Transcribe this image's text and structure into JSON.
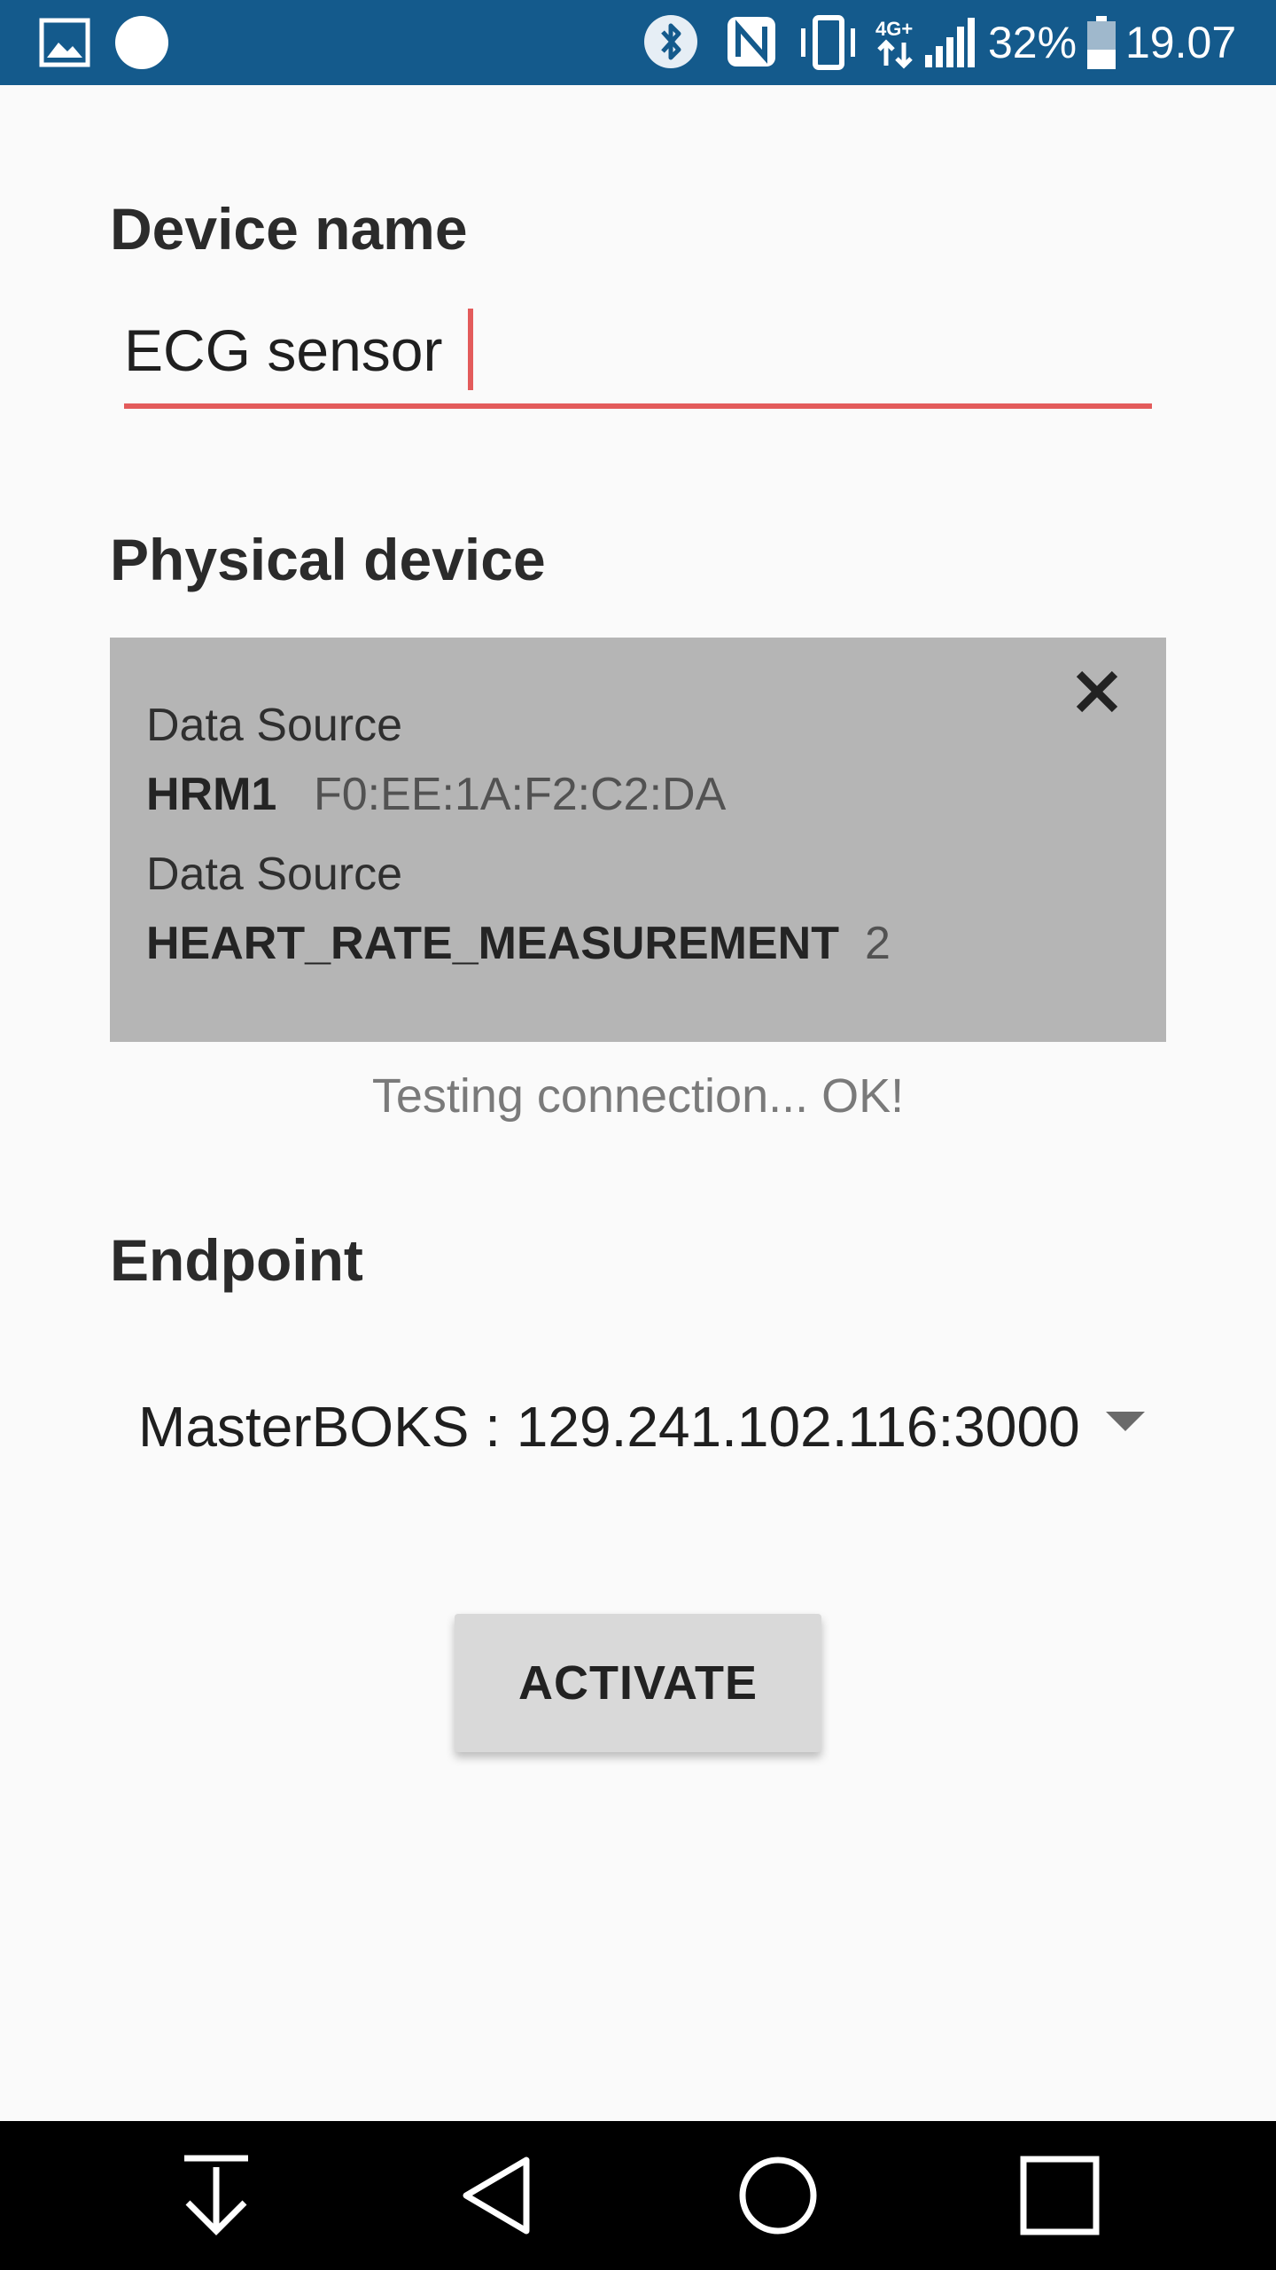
{
  "status_bar": {
    "battery_percent": "32%",
    "time": "19.07",
    "network_label": "4G+",
    "bg_color": "#145a8c",
    "icons": [
      "image-icon",
      "circle-icon",
      "bluetooth-icon",
      "nfc-icon",
      "vibrate-icon",
      "network-icon",
      "signal-icon",
      "battery-icon"
    ]
  },
  "device_name": {
    "heading": "Device name",
    "value": "ECG sensor",
    "accent_color": "#e35b5b"
  },
  "physical_device": {
    "heading": "Physical device",
    "source1": {
      "label": "Data Source",
      "name": "HRM1",
      "value": "F0:EE:1A:F2:C2:DA"
    },
    "source2": {
      "label": "Data Source",
      "name": "HEART_RATE_MEASUREMENT",
      "value": "2"
    },
    "status": "Testing connection... OK!"
  },
  "endpoint": {
    "heading": "Endpoint",
    "selected": "MasterBOKS : 129.241.102.116:3000"
  },
  "actions": {
    "activate_label": "ACTIVATE"
  },
  "nav": {
    "icons": [
      "download-icon",
      "back-icon",
      "home-icon",
      "recents-icon"
    ]
  }
}
